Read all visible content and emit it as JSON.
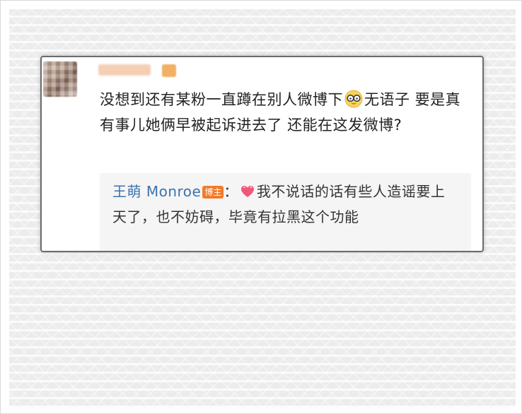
{
  "comment": {
    "text_before_emoji": "没想到还有某粉一直蹲在别人微博下",
    "emoji": "glasses-face-emoji",
    "text_after_emoji": "无语子 要是真有事儿她俩早被起诉进去了 还能在这发微博?"
  },
  "reply": {
    "author": "王萌 Monroe",
    "author_badge": "博主",
    "separator": "：",
    "emoji": "heart-emoji",
    "text": "我不说话的话有些人造谣要上天了，也不妨碍，毕竟有拉黑这个功能"
  },
  "colors": {
    "author_link": "#3b73ad",
    "badge_bg": "#f37a2a",
    "reply_bg": "#f5f5f5"
  }
}
